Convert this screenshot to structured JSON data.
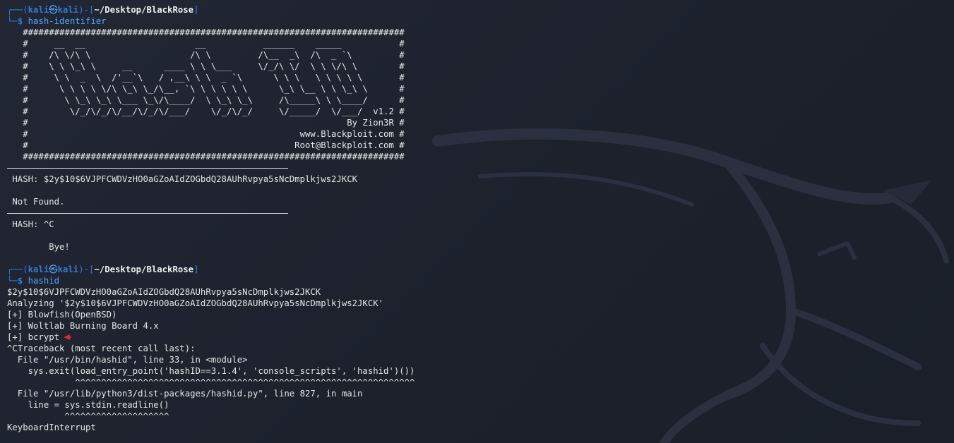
{
  "prompts": [
    {
      "corner_top": "┌──(",
      "user": "kali",
      "at": "㉿",
      "host": "kali",
      "mid": ")-[",
      "path": "~/Desktop/BlackRose",
      "close": "]",
      "corner_bottom": "└─",
      "dollar": "$",
      "command": "hash-identifier"
    },
    {
      "corner_top": "┌──(",
      "user": "kali",
      "at": "㉿",
      "host": "kali",
      "mid": ")-[",
      "path": "~/Desktop/BlackRose",
      "close": "]",
      "corner_bottom": "└─",
      "dollar": "$",
      "command": "hashid"
    }
  ],
  "banner": [
    "   #########################################################################",
    "   #     __  __                     __           ______    _____           #",
    "   #    /\\ \\/\\ \\                   /\\ \\         /\\__  _\\  /\\  _ `\\         #",
    "   #    \\ \\ \\_\\ \\     __      ____ \\ \\ \\___     \\/_/\\ \\/  \\ \\ \\/\\ \\        #",
    "   #     \\ \\  _  \\  /'__`\\   / ,__\\ \\ \\  _ `\\      \\ \\ \\   \\ \\ \\ \\ \\       #",
    "   #      \\ \\ \\ \\ \\/\\ \\_\\ \\_/\\__, `\\ \\ \\ \\ \\ \\      \\_\\ \\__ \\ \\ \\_\\ \\      #",
    "   #       \\ \\_\\ \\_\\ \\___ \\_\\/\\____/  \\ \\_\\ \\_\\     /\\_____\\ \\ \\____/      #",
    "   #        \\/_/\\/_/\\/__/\\/_/\\/___/    \\/_/\\/_/     \\/_____/  \\/___/  v1.2 #",
    "   #                                                             By Zion3R #",
    "   #                                                    www.Blackploit.com #",
    "   #                                                   Root@Blackploit.com #",
    "   #########################################################################"
  ],
  "hash_identifier": {
    "hash_line": " HASH: $2y$10$6VJPFCWDVzHO0aGZoAIdZOGbdQ28AUhRvpya5sNcDmplkjws2JKCK",
    "not_found": " Not Found.",
    "hash_ctrl_c": " HASH: ^C",
    "bye": "        Bye!"
  },
  "hashid": {
    "input": "$2y$10$6VJPFCWDVzHO0aGZoAIdZOGbdQ28AUhRvpya5sNcDmplkjws2JKCK",
    "analyzing": "Analyzing '$2y$10$6VJPFCWDVzHO0aGZoAIdZOGbdQ28AUhRvpya5sNcDmplkjws2JKCK'",
    "result_1": "[+] Blowfish(OpenBSD)",
    "result_2": "[+] Woltlab Burning Board 4.x",
    "result_3": "[+] bcrypt",
    "traceback_1": "^CTraceback (most recent call last):",
    "traceback_2": "  File \"/usr/bin/hashid\", line 33, in <module>",
    "traceback_3": "    sys.exit(load_entry_point('hashID==3.1.4', 'console_scripts', 'hashid')())",
    "traceback_4": "             ^^^^^^^^^^^^^^^^^^^^^^^^^^^^^^^^^^^^^^^^^^^^^^^^^^^^^^^^^^^^^^^^^",
    "traceback_5": "  File \"/usr/lib/python3/dist-packages/hashid.py\", line 827, in main",
    "traceback_6": "    line = sys.stdin.readline()",
    "traceback_7": "           ^^^^^^^^^^^^^^^^^^^^",
    "keyboard_interrupt": "KeyboardInterrupt"
  },
  "colors": {
    "background": "#1f2430",
    "prompt_blue": "#2f7bd8",
    "command_blue": "#4fa6ff",
    "text": "#e6e6e6",
    "arrow_red": "#e3262d"
  },
  "icons": {
    "annotation_arrow": "red-arrow-icon",
    "background_logo": "kali-dragon-icon"
  }
}
